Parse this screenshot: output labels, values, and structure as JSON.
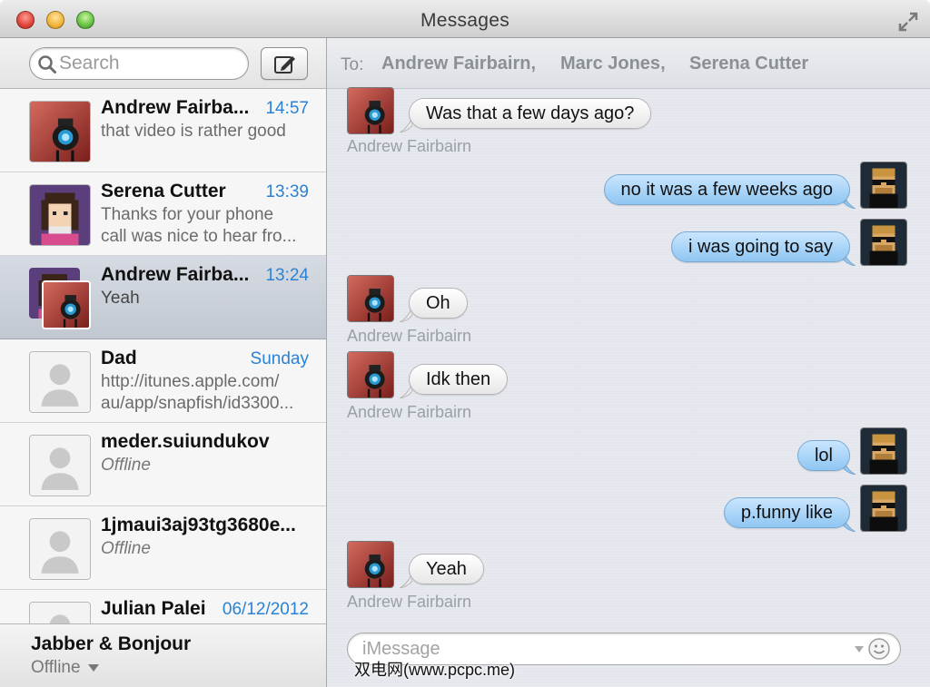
{
  "window": {
    "title": "Messages"
  },
  "sidebar": {
    "search_placeholder": "Search",
    "conversations": [
      {
        "name": "Andrew Fairba...",
        "time": "14:57",
        "preview": "that video is rather good"
      },
      {
        "name": "Serena Cutter",
        "time": "13:39",
        "preview_lines": [
          "Thanks for your phone",
          "call was nice to hear fro..."
        ]
      },
      {
        "name": "Andrew Fairba...",
        "time": "13:24",
        "preview": "Yeah"
      },
      {
        "name": "Dad",
        "time": "Sunday",
        "preview_lines": [
          "http://itunes.apple.com/",
          "au/app/snapfish/id3300..."
        ]
      },
      {
        "name": "meder.suiundukov",
        "time": "",
        "preview": "Offline"
      },
      {
        "name": "1jmaui3aj93tg3680e...",
        "time": "",
        "preview": "Offline"
      },
      {
        "name": "Julian Palei",
        "time": "06/12/2012",
        "preview": ""
      }
    ],
    "account": {
      "name": "Jabber & Bonjour",
      "status": "Offline"
    }
  },
  "chat": {
    "to_label": "To:",
    "recipients": [
      "Andrew Fairbairn",
      "Marc Jones",
      "Serena Cutter"
    ],
    "messages": [
      {
        "direction": "in",
        "text": "Was that a few days ago?",
        "sender": "Andrew Fairbairn"
      },
      {
        "direction": "out",
        "text": "no it was a few weeks ago"
      },
      {
        "direction": "out",
        "text": "i was going to say"
      },
      {
        "direction": "in",
        "text": "Oh",
        "sender": "Andrew Fairbairn"
      },
      {
        "direction": "in",
        "text": "Idk then",
        "sender": "Andrew Fairbairn"
      },
      {
        "direction": "out",
        "text": "lol"
      },
      {
        "direction": "out",
        "text": "p.funny like"
      },
      {
        "direction": "in",
        "text": "Yeah",
        "sender": "Andrew Fairbairn"
      }
    ],
    "input_placeholder": "iMessage"
  },
  "colors": {
    "time_blue": "#2a82d6",
    "outgoing_bubble": "#a9d4f7",
    "incoming_bubble": "#f2f2f2"
  },
  "icons": {
    "search": "search-icon",
    "compose": "compose-icon",
    "fullscreen": "fullscreen-icon",
    "smiley": "smiley-icon"
  },
  "watermark": "双电网(www.pcpc.me)"
}
